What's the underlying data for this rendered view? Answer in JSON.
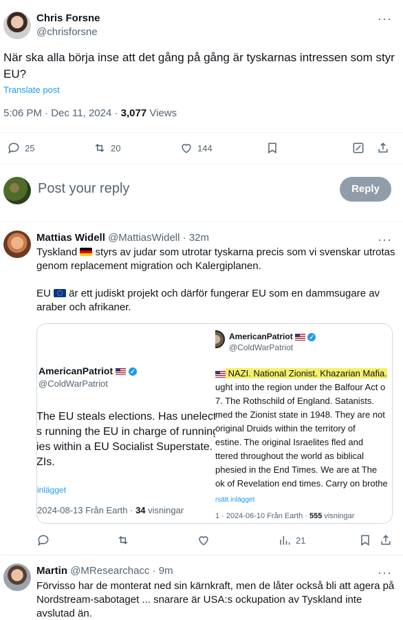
{
  "main_tweet": {
    "author_name": "Chris Forsne",
    "author_handle": "@chrisforsne",
    "text": "När ska alla börja inse  att det  gång på gång är tyskarnas intressen  som styr EU?",
    "translate_label": "Translate post",
    "timestamp": "5:06 PM · Dec 11, 2024 · ",
    "views_count": "3,077",
    "views_label": " Views",
    "actions": {
      "replies": "25",
      "reposts": "20",
      "likes": "144"
    }
  },
  "compose": {
    "placeholder": "Post your reply",
    "reply_button": "Reply"
  },
  "replies": [
    {
      "author_name": "Mattias Widell",
      "author_handle": "@MattiasWidell",
      "time": " · 32m",
      "text_1a": "Tyskland ",
      "text_1b": " styrs av judar som utrotar tyskarna precis som vi svenskar utrotas genom replacement migration och Kalergiplanen.",
      "text_2a": "EU ",
      "text_2b": " är ett judiskt projekt och därför fungerar EU som en dammsugare av araber och afrikaner.",
      "actions": {
        "views": "21"
      },
      "quote_left": {
        "name": "AmericanPatriot",
        "handle": "@ColdWarPatriot",
        "lines": [
          "The EU steals elections. Has unelect",
          "s running the EU in charge of running",
          "ies within a EU Socialist Superstate.",
          "ZIs."
        ],
        "link": " inlägget",
        "meta_date": "2024-08-13 Från Earth · ",
        "meta_views": "34",
        "meta_views_label": " visningar"
      },
      "quote_right": {
        "name": "AmericanPatriot",
        "handle": "@ColdWarPatriot",
        "highlight": " NAZI. National Zionist. Khazarian Mafia.",
        "lines": [
          "ught into the region under the Balfour Act o",
          "7. The Rothschild of England. Satanists.",
          "med the Zionist state in 1948. They are not",
          "original Druids within the territory of",
          "estine. The original Israelites fled and",
          "ttered throughout the world as biblical",
          "phesied in the End Times. We are at The",
          "ok of Revelation end times. Carry on brothe"
        ],
        "link": "rsätt inlägget",
        "meta_date": "1 · 2024-06-10 Från Earth · ",
        "meta_views": "555",
        "meta_views_label": " visningar"
      }
    },
    {
      "author_name": "Martin",
      "author_handle": "@MResearchacc",
      "time": " · 9m",
      "text": "Förvisso har de monterat ned sin kärnkraft, men de låter också bli att agera på Nordstream-sabotaget ... snarare är USA:s ockupation av Tyskland inte avslutad än."
    }
  ],
  "icons": {
    "reply": "reply-icon",
    "repost": "repost-icon",
    "like": "heart-icon",
    "bookmark": "bookmark-icon",
    "grok": "edit-box-icon",
    "share": "share-icon",
    "views": "views-icon",
    "more": "more-icon"
  },
  "colors": {
    "accent": "#1d9bf0",
    "muted": "#536471",
    "reply_button_bg": "#8b98a5",
    "highlight": "#f3f06a"
  }
}
